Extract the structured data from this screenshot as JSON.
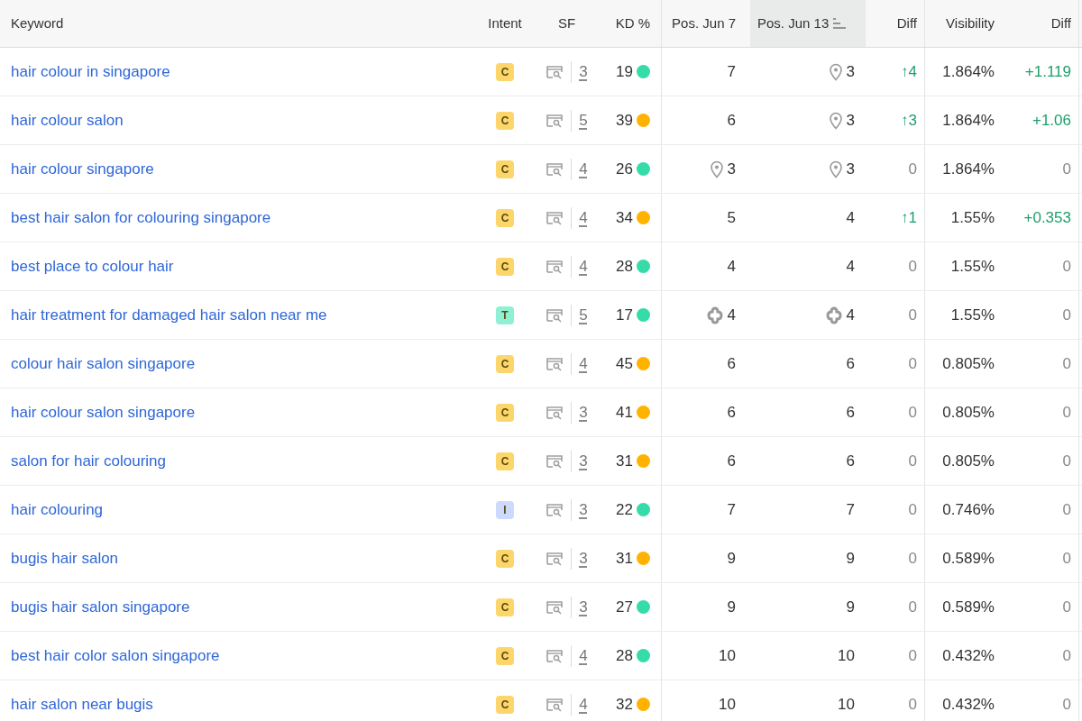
{
  "columns": [
    {
      "label": "Keyword",
      "sorted": false
    },
    {
      "label": "Intent",
      "sorted": false
    },
    {
      "label": "SF",
      "sorted": false
    },
    {
      "label": "KD %",
      "sorted": false
    },
    {
      "label": "Pos. Jun 7",
      "sorted": false
    },
    {
      "label": "Pos. Jun 13",
      "sorted": true
    },
    {
      "label": "Diff",
      "sorted": false
    },
    {
      "label": "Visibility",
      "sorted": false
    },
    {
      "label": "Diff",
      "sorted": false
    }
  ],
  "rows": [
    {
      "keyword": "hair colour in singapore",
      "intent": {
        "letter": "C",
        "color": "#fcd66b"
      },
      "sf": "3",
      "kd": {
        "value": "19",
        "color": "#35dba8"
      },
      "pos_prev": {
        "value": "7",
        "kind": "plain"
      },
      "pos_cur": {
        "value": "3",
        "kind": "pin"
      },
      "diff": {
        "text": "↑4",
        "up": true
      },
      "visibility": "1.864%",
      "visibility_diff": {
        "text": "+1.119",
        "up": true
      }
    },
    {
      "keyword": "hair colour salon",
      "intent": {
        "letter": "C",
        "color": "#fcd66b"
      },
      "sf": "5",
      "kd": {
        "value": "39",
        "color": "#ffb300"
      },
      "pos_prev": {
        "value": "6",
        "kind": "plain"
      },
      "pos_cur": {
        "value": "3",
        "kind": "pin"
      },
      "diff": {
        "text": "↑3",
        "up": true
      },
      "visibility": "1.864%",
      "visibility_diff": {
        "text": "+1.06",
        "up": true
      }
    },
    {
      "keyword": "hair colour singapore",
      "intent": {
        "letter": "C",
        "color": "#fcd66b"
      },
      "sf": "4",
      "kd": {
        "value": "26",
        "color": "#35dba8"
      },
      "pos_prev": {
        "value": "3",
        "kind": "pin"
      },
      "pos_cur": {
        "value": "3",
        "kind": "pin"
      },
      "diff": {
        "text": "0",
        "up": false
      },
      "visibility": "1.864%",
      "visibility_diff": {
        "text": "0",
        "up": false
      }
    },
    {
      "keyword": "best hair salon for colouring singapore",
      "intent": {
        "letter": "C",
        "color": "#fcd66b"
      },
      "sf": "4",
      "kd": {
        "value": "34",
        "color": "#ffb300"
      },
      "pos_prev": {
        "value": "5",
        "kind": "plain"
      },
      "pos_cur": {
        "value": "4",
        "kind": "plain"
      },
      "diff": {
        "text": "↑1",
        "up": true
      },
      "visibility": "1.55%",
      "visibility_diff": {
        "text": "+0.353",
        "up": true
      }
    },
    {
      "keyword": "best place to colour hair",
      "intent": {
        "letter": "C",
        "color": "#fcd66b"
      },
      "sf": "4",
      "kd": {
        "value": "28",
        "color": "#35dba8"
      },
      "pos_prev": {
        "value": "4",
        "kind": "plain"
      },
      "pos_cur": {
        "value": "4",
        "kind": "plain"
      },
      "diff": {
        "text": "0",
        "up": false
      },
      "visibility": "1.55%",
      "visibility_diff": {
        "text": "0",
        "up": false
      }
    },
    {
      "keyword": "hair treatment for damaged hair salon near me",
      "intent": {
        "letter": "T",
        "color": "#8ff0d3"
      },
      "sf": "5",
      "kd": {
        "value": "17",
        "color": "#35dba8"
      },
      "pos_prev": {
        "value": "4",
        "kind": "clover"
      },
      "pos_cur": {
        "value": "4",
        "kind": "clover"
      },
      "diff": {
        "text": "0",
        "up": false
      },
      "visibility": "1.55%",
      "visibility_diff": {
        "text": "0",
        "up": false
      }
    },
    {
      "keyword": "colour hair salon singapore",
      "intent": {
        "letter": "C",
        "color": "#fcd66b"
      },
      "sf": "4",
      "kd": {
        "value": "45",
        "color": "#ffb300"
      },
      "pos_prev": {
        "value": "6",
        "kind": "plain"
      },
      "pos_cur": {
        "value": "6",
        "kind": "plain"
      },
      "diff": {
        "text": "0",
        "up": false
      },
      "visibility": "0.805%",
      "visibility_diff": {
        "text": "0",
        "up": false
      }
    },
    {
      "keyword": "hair colour salon singapore",
      "intent": {
        "letter": "C",
        "color": "#fcd66b"
      },
      "sf": "3",
      "kd": {
        "value": "41",
        "color": "#ffb300"
      },
      "pos_prev": {
        "value": "6",
        "kind": "plain"
      },
      "pos_cur": {
        "value": "6",
        "kind": "plain"
      },
      "diff": {
        "text": "0",
        "up": false
      },
      "visibility": "0.805%",
      "visibility_diff": {
        "text": "0",
        "up": false
      }
    },
    {
      "keyword": "salon for hair colouring",
      "intent": {
        "letter": "C",
        "color": "#fcd66b"
      },
      "sf": "3",
      "kd": {
        "value": "31",
        "color": "#ffb300"
      },
      "pos_prev": {
        "value": "6",
        "kind": "plain"
      },
      "pos_cur": {
        "value": "6",
        "kind": "plain"
      },
      "diff": {
        "text": "0",
        "up": false
      },
      "visibility": "0.805%",
      "visibility_diff": {
        "text": "0",
        "up": false
      }
    },
    {
      "keyword": "hair colouring",
      "intent": {
        "letter": "I",
        "color": "#cddafd"
      },
      "sf": "3",
      "kd": {
        "value": "22",
        "color": "#35dba8"
      },
      "pos_prev": {
        "value": "7",
        "kind": "plain"
      },
      "pos_cur": {
        "value": "7",
        "kind": "plain"
      },
      "diff": {
        "text": "0",
        "up": false
      },
      "visibility": "0.746%",
      "visibility_diff": {
        "text": "0",
        "up": false
      }
    },
    {
      "keyword": "bugis hair salon",
      "intent": {
        "letter": "C",
        "color": "#fcd66b"
      },
      "sf": "3",
      "kd": {
        "value": "31",
        "color": "#ffb300"
      },
      "pos_prev": {
        "value": "9",
        "kind": "plain"
      },
      "pos_cur": {
        "value": "9",
        "kind": "plain"
      },
      "diff": {
        "text": "0",
        "up": false
      },
      "visibility": "0.589%",
      "visibility_diff": {
        "text": "0",
        "up": false
      }
    },
    {
      "keyword": "bugis hair salon singapore",
      "intent": {
        "letter": "C",
        "color": "#fcd66b"
      },
      "sf": "3",
      "kd": {
        "value": "27",
        "color": "#35dba8"
      },
      "pos_prev": {
        "value": "9",
        "kind": "plain"
      },
      "pos_cur": {
        "value": "9",
        "kind": "plain"
      },
      "diff": {
        "text": "0",
        "up": false
      },
      "visibility": "0.589%",
      "visibility_diff": {
        "text": "0",
        "up": false
      }
    },
    {
      "keyword": "best hair color salon singapore",
      "intent": {
        "letter": "C",
        "color": "#fcd66b"
      },
      "sf": "4",
      "kd": {
        "value": "28",
        "color": "#35dba8"
      },
      "pos_prev": {
        "value": "10",
        "kind": "plain"
      },
      "pos_cur": {
        "value": "10",
        "kind": "plain"
      },
      "diff": {
        "text": "0",
        "up": false
      },
      "visibility": "0.432%",
      "visibility_diff": {
        "text": "0",
        "up": false
      }
    },
    {
      "keyword": "hair salon near bugis",
      "intent": {
        "letter": "C",
        "color": "#fcd66b"
      },
      "sf": "4",
      "kd": {
        "value": "32",
        "color": "#ffb300"
      },
      "pos_prev": {
        "value": "10",
        "kind": "plain"
      },
      "pos_cur": {
        "value": "10",
        "kind": "plain"
      },
      "diff": {
        "text": "0",
        "up": false
      },
      "visibility": "0.432%",
      "visibility_diff": {
        "text": "0",
        "up": false
      }
    }
  ]
}
